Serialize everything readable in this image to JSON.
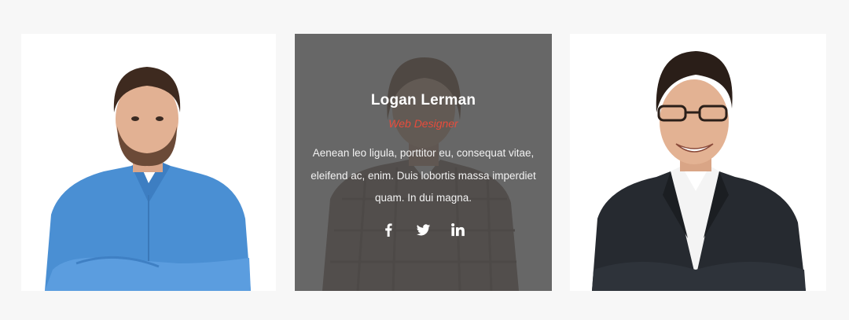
{
  "colors": {
    "page_background": "#f7f7f7",
    "card_background": "#ffffff",
    "overlay": "#555555",
    "role_accent": "#e74c3c",
    "text_light": "#ffffff"
  },
  "team": [
    {
      "photo_icon": "man-blue-shirt-photo"
    },
    {
      "name": "Logan Lerman",
      "role": "Web Designer",
      "bio": "Aenean leo ligula, porttitor eu, consequat vitae, eleifend ac, enim. Duis lobortis massa imperdiet quam. In dui magna.",
      "social": [
        "facebook-icon",
        "twitter-icon",
        "linkedin-icon"
      ]
    },
    {
      "photo_icon": "man-dark-suit-glasses-photo"
    }
  ]
}
